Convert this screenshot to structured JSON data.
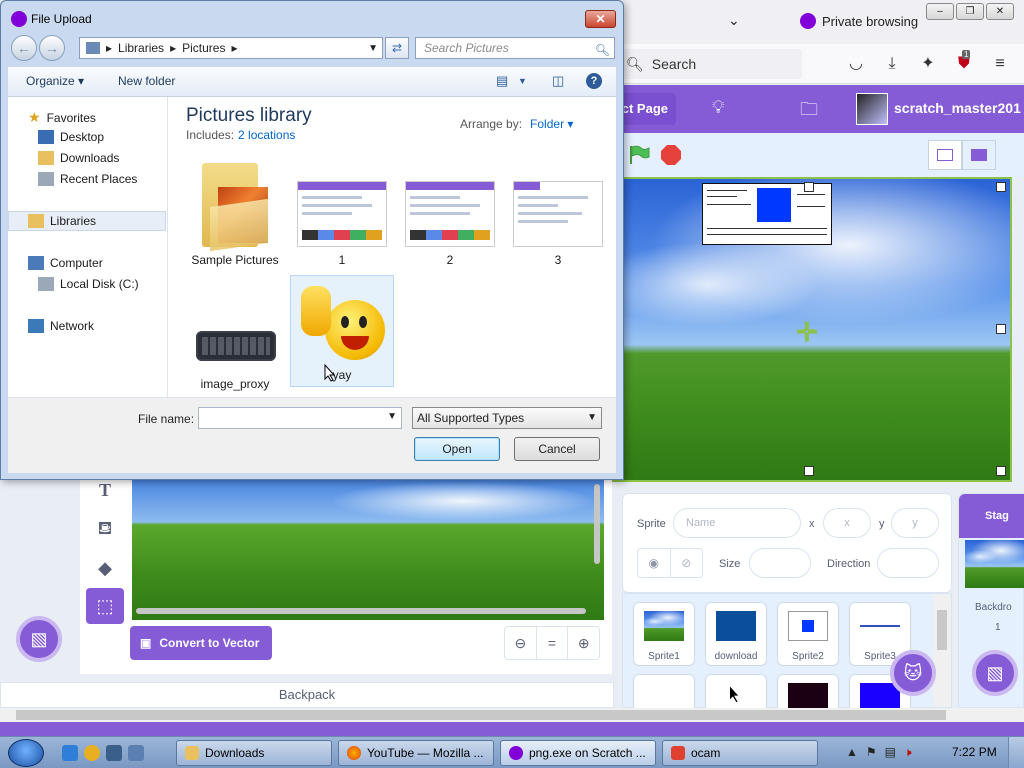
{
  "browser": {
    "private_label": "Private browsing",
    "search_placeholder": "Search",
    "ublock_badge": "1"
  },
  "scratch": {
    "project_page_label": "ct Page",
    "username": "scratch_master201",
    "sprite_info": {
      "sprite_label": "Sprite",
      "name_placeholder": "Name",
      "x_label": "x",
      "x_placeholder": "x",
      "y_label": "y",
      "y_placeholder": "y",
      "size_label": "Size",
      "direction_label": "Direction"
    },
    "sprites": [
      "Sprite1",
      "download",
      "Sprite2",
      "Sprite3"
    ],
    "stage_tab_label": "Stag",
    "backdrops_label": "Backdro",
    "backdrops_count": "1",
    "convert_button": "Convert to Vector",
    "zoom_reset": "=",
    "backpack_label": "Backpack"
  },
  "dialog": {
    "title": "File Upload",
    "breadcrumb": [
      "Libraries",
      "Pictures"
    ],
    "search_placeholder": "Search Pictures",
    "organize_label": "Organize",
    "new_folder_label": "New folder",
    "nav": {
      "favorites": "Favorites",
      "desktop": "Desktop",
      "downloads": "Downloads",
      "recent_places": "Recent Places",
      "libraries": "Libraries",
      "computer": "Computer",
      "local_disk": "Local Disk (C:)",
      "network": "Network"
    },
    "library_title": "Pictures library",
    "includes_label": "Includes:",
    "includes_locations": "2 locations",
    "arrange_label": "Arrange by:",
    "arrange_value": "Folder",
    "files": [
      "Sample Pictures",
      "1",
      "2",
      "3",
      "image_proxy",
      "yay"
    ],
    "file_name_label": "File name:",
    "file_name_value": "",
    "file_type_value": "All Supported Types",
    "open_button": "Open",
    "cancel_button": "Cancel"
  },
  "taskbar": {
    "items": [
      "Downloads",
      "YouTube — Mozilla ...",
      "png.exe on Scratch ...",
      "ocam"
    ],
    "clock": "7:22 PM"
  },
  "colors": {
    "scratch_purple": "#855cd6",
    "stage_select_green": "#8cc24a",
    "stop_red": "#e6413a",
    "link_blue": "#0066cc"
  }
}
